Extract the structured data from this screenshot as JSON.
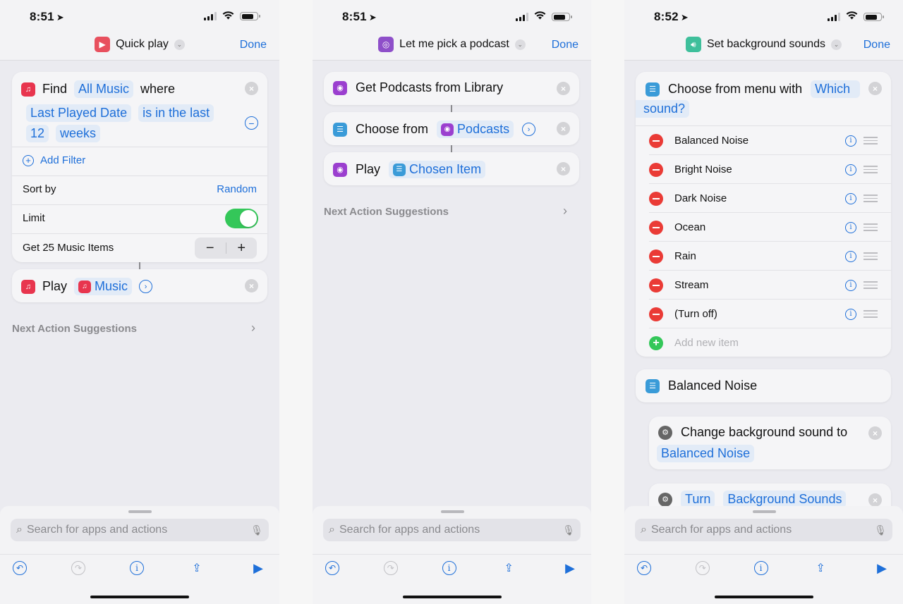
{
  "screens": [
    {
      "status": {
        "time": "8:51"
      },
      "nav": {
        "title": "Quick play",
        "done": "Done",
        "icon_color": "#e8505e"
      },
      "find": {
        "verb": "Find",
        "source": "All Music",
        "where": "where",
        "filter_field": "Last Played Date",
        "filter_op": "is in the last",
        "filter_value": "12",
        "filter_unit": "weeks",
        "add_filter": "Add Filter",
        "sort_label": "Sort by",
        "sort_value": "Random",
        "limit_label": "Limit",
        "limit_on": true,
        "get_label": "Get 25 Music Items",
        "stepper_minus": "−",
        "stepper_plus": "+"
      },
      "play": {
        "verb": "Play",
        "token": "Music"
      },
      "suggestions": "Next Action Suggestions",
      "search_placeholder": "Search for apps and actions"
    },
    {
      "status": {
        "time": "8:51"
      },
      "nav": {
        "title": "Let me pick a podcast",
        "done": "Done",
        "icon_color": "#8e4fc9"
      },
      "actions": [
        {
          "text": "Get Podcasts from Library"
        },
        {
          "text": "Choose from",
          "token": "Podcasts"
        },
        {
          "text": "Play",
          "token": "Chosen Item"
        }
      ],
      "suggestions": "Next Action Suggestions",
      "search_placeholder": "Search for apps and actions"
    },
    {
      "status": {
        "time": "8:52"
      },
      "nav": {
        "title": "Set background sounds",
        "done": "Done",
        "icon_color": "#3ebf9b"
      },
      "menu": {
        "text": "Choose from menu with",
        "prompt_line1": "Which",
        "prompt_line2": "sound?",
        "items": [
          "Balanced Noise",
          "Bright Noise",
          "Dark Noise",
          "Ocean",
          "Rain",
          "Stream",
          "(Turn off)"
        ],
        "add_item": "Add new item"
      },
      "case_label": "Balanced Noise",
      "change": {
        "text": "Change background sound to",
        "token": "Balanced Noise"
      },
      "turn": {
        "token1": "Turn",
        "token2": "Background Sounds"
      },
      "search_placeholder": "Search for apps and actions"
    }
  ]
}
